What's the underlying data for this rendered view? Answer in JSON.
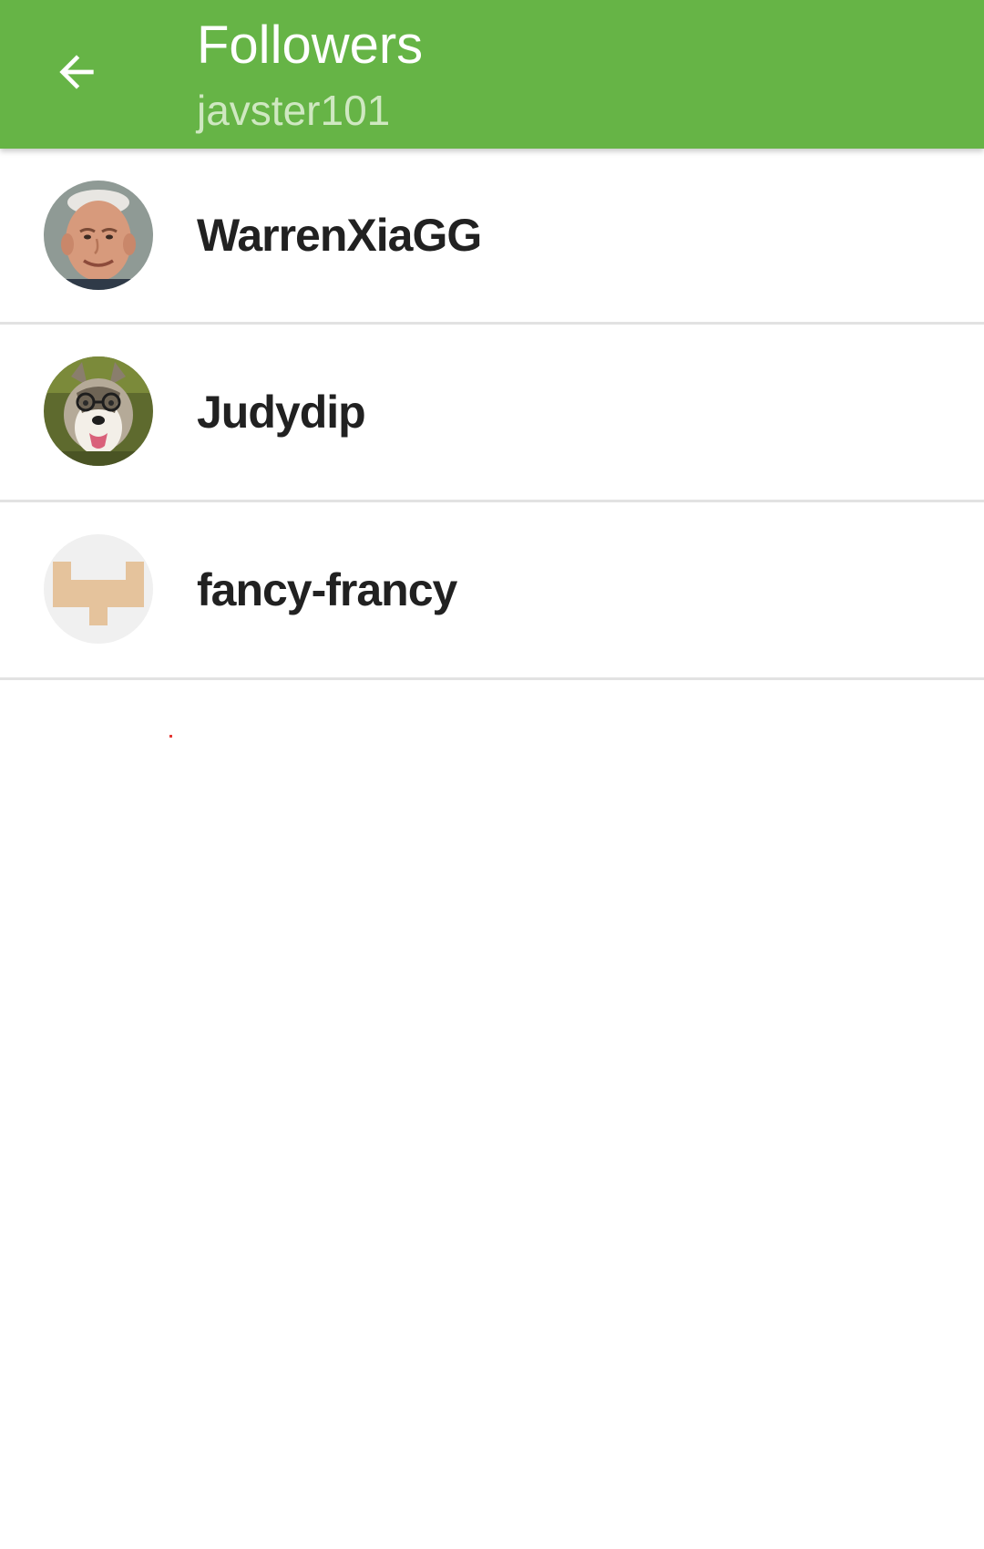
{
  "colors": {
    "appbar": "#66b446",
    "title": "#ffffff",
    "subtitle": "#cfe8c1",
    "username": "#212121",
    "divider": "#e2e2e2",
    "identicon": "#e5c39c",
    "identicon_bg": "#f0f0f0"
  },
  "header": {
    "back_icon": "arrow-back-icon",
    "title": "Followers",
    "subtitle": "javster101"
  },
  "followers": [
    {
      "username": "WarrenXiaGG",
      "avatar": "photo-avatar-man"
    },
    {
      "username": "Judydip",
      "avatar": "photo-avatar-husky-glasses"
    },
    {
      "username": "fancy-francy",
      "avatar": "identicon-avatar"
    }
  ]
}
